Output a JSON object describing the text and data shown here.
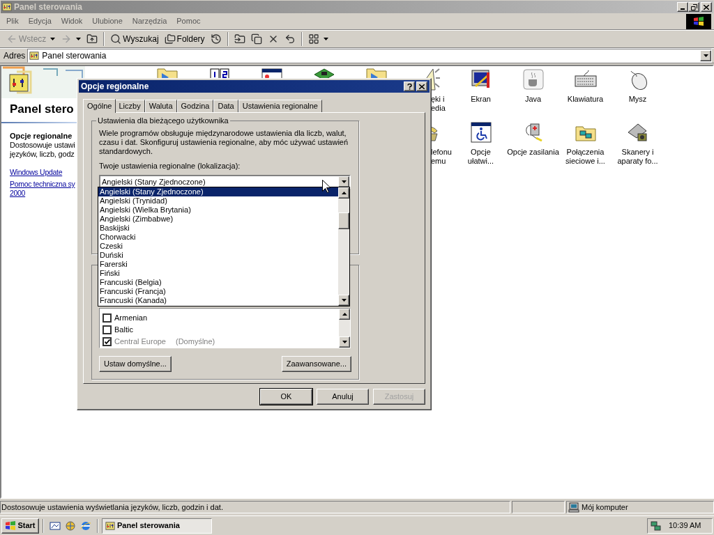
{
  "window": {
    "title": "Panel sterowania",
    "active": false
  },
  "menu": [
    "Plik",
    "Edycja",
    "Widok",
    "Ulubione",
    "Narzędzia",
    "Pomoc"
  ],
  "toolbar": [
    {
      "kind": "back",
      "label": "Wstecz",
      "disabled": true,
      "dropdown": true
    },
    {
      "kind": "forward",
      "disabled": true,
      "dropdown": true
    },
    {
      "kind": "up",
      "disabled": false,
      "dropdown": false
    },
    {
      "kind": "separator"
    },
    {
      "kind": "search",
      "label": "Wyszukaj",
      "disabled": false,
      "dropdown": false
    },
    {
      "kind": "folders",
      "label": "Foldery",
      "disabled": false,
      "dropdown": false
    },
    {
      "kind": "history",
      "disabled": false,
      "dropdown": false
    },
    {
      "kind": "separator"
    },
    {
      "kind": "move",
      "disabled": false,
      "dropdown": false
    },
    {
      "kind": "copy",
      "disabled": false,
      "dropdown": false
    },
    {
      "kind": "delete",
      "disabled": false,
      "dropdown": false
    },
    {
      "kind": "undo",
      "disabled": false,
      "dropdown": false
    },
    {
      "kind": "separator"
    },
    {
      "kind": "views",
      "disabled": false,
      "dropdown": true
    }
  ],
  "address": {
    "label": "Adres",
    "value": "Panel sterowania"
  },
  "left_pane": {
    "title": "Panel stero",
    "item_title": "Opcje regionalne",
    "item_description": [
      "Dostosowuje ustawi",
      "języków, liczb, godz"
    ],
    "links": [
      [
        "Windows Update"
      ],
      [
        "Pomoc techniczna sy",
        "2000"
      ]
    ]
  },
  "icons_row_1": [
    {
      "kind": "folder"
    },
    {
      "kind": "numbers"
    },
    {
      "kind": "window"
    },
    {
      "kind": "card"
    },
    {
      "kind": "folder"
    },
    {
      "kind": "speaker",
      "label": [
        "ęki i",
        "edia"
      ]
    },
    {
      "kind": "monitor",
      "label": [
        "Ekran"
      ]
    },
    {
      "kind": "java",
      "label": [
        "Java"
      ]
    },
    {
      "kind": "keyboard",
      "label": [
        "Klawiatura"
      ]
    },
    {
      "kind": "mouse",
      "label": [
        "Mysz"
      ]
    }
  ],
  "icons_row_2": [
    {
      "kind": "phone",
      "label": [
        "lefonu",
        "emu"
      ]
    },
    {
      "kind": "accessibility",
      "label": [
        "Opcje",
        "ułatwi..."
      ]
    },
    {
      "kind": "power",
      "label": [
        "Opcje zasilania"
      ]
    },
    {
      "kind": "network",
      "label": [
        "Połączenia",
        "sieciowe i..."
      ]
    },
    {
      "kind": "scanner",
      "label": [
        "Skanery i",
        "aparaty fo..."
      ]
    }
  ],
  "dialog": {
    "title": "Opcje regionalne",
    "tabs": [
      {
        "label": "Ogólne",
        "selected": true
      },
      {
        "label": "Liczby",
        "selected": false
      },
      {
        "label": "Waluta",
        "selected": false
      },
      {
        "label": "Godzina",
        "selected": false
      },
      {
        "label": "Data",
        "selected": false
      },
      {
        "label": "Ustawienia regionalne",
        "selected": false
      }
    ],
    "group_title": "Ustawienia dla bieżącego użytkownika",
    "description": "Wiele programów obsługuje międzynarodowe ustawienia dla liczb, walut, czasu i dat. Skonfiguruj ustawienia regionalne, aby móc używać ustawień standardowych.",
    "locale_label": "Twoje ustawienia regionalne (lokalizacja):",
    "locale_value": "Angielski (Stany Zjednoczone)",
    "locale_options": [
      {
        "label": "Angielski (Stany Zjednoczone)",
        "selected": true
      },
      {
        "label": "Angielski (Trynidad)",
        "selected": false
      },
      {
        "label": "Angielski (Wielka Brytania)",
        "selected": false
      },
      {
        "label": "Angielski (Zimbabwe)",
        "selected": false
      },
      {
        "label": "Baskijski",
        "selected": false
      },
      {
        "label": "Chorwacki",
        "selected": false
      },
      {
        "label": "Czeski",
        "selected": false
      },
      {
        "label": "Duński",
        "selected": false
      },
      {
        "label": "Farerski",
        "selected": false
      },
      {
        "label": "Fiński",
        "selected": false
      },
      {
        "label": "Francuski (Belgia)",
        "selected": false
      },
      {
        "label": "Francuski (Francja)",
        "selected": false
      },
      {
        "label": "Francuski (Kanada)",
        "selected": false
      }
    ],
    "code_pages": [
      {
        "label": "Armenian",
        "checked": false,
        "disabled": false
      },
      {
        "label": "Baltic",
        "checked": false,
        "disabled": false
      },
      {
        "label": "Central Europe",
        "note": "(Domyślne)",
        "checked": true,
        "disabled": true
      }
    ],
    "group_buttons": [
      "Ustaw domyślne...",
      "Zaawansowane..."
    ],
    "buttons": [
      {
        "label": "OK",
        "default": true,
        "disabled": false
      },
      {
        "label": "Anuluj",
        "default": false,
        "disabled": false
      },
      {
        "label": "Zastosuj",
        "default": false,
        "disabled": true
      }
    ]
  },
  "status_bar": {
    "text": "Dostosowuje ustawienia wyświetlania języków, liczb, godzin i dat.",
    "zone": "Mój komputer"
  },
  "taskbar": {
    "start": "Start",
    "quick_launch": [
      {
        "kind": "desktop"
      },
      {
        "kind": "channels"
      },
      {
        "kind": "browser"
      }
    ],
    "tasks": [
      {
        "label": "Panel sterowania",
        "selected": true
      }
    ],
    "clock": "10:39 AM"
  }
}
